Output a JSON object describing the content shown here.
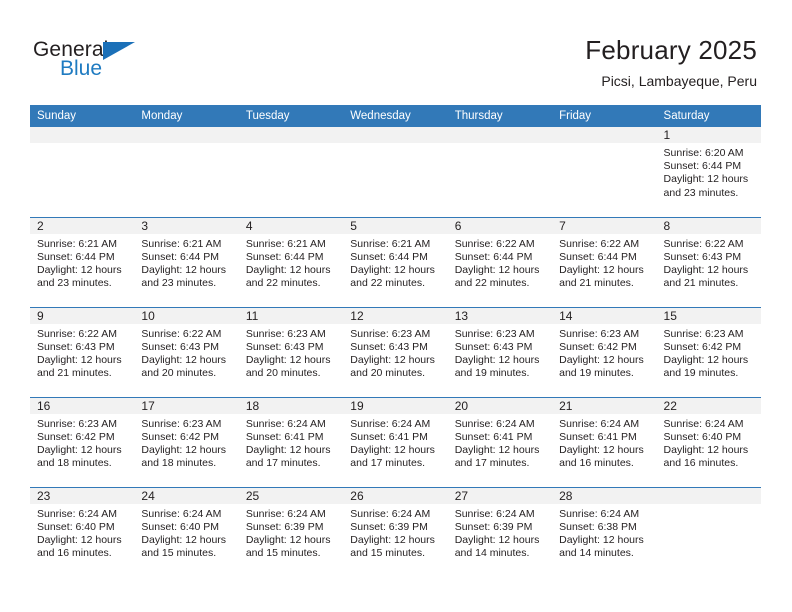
{
  "brand": {
    "name_part1": "General",
    "name_part2": "Blue",
    "triangle_color": "#1b70b8",
    "text_color": "#231f20",
    "blue_color": "#1f7bc1"
  },
  "header": {
    "title": "February 2025",
    "subtitle": "Picsi, Lambayeque, Peru"
  },
  "theme": {
    "header_bg": "#3279b8",
    "header_text": "#ffffff",
    "daynum_bg": "#f2f2f2",
    "grid_line": "#3279b8",
    "body_text": "#231f20"
  },
  "calendar": {
    "weekday_headers": [
      "Sunday",
      "Monday",
      "Tuesday",
      "Wednesday",
      "Thursday",
      "Friday",
      "Saturday"
    ],
    "weeks": [
      [
        {
          "day": "",
          "empty": true
        },
        {
          "day": "",
          "empty": true
        },
        {
          "day": "",
          "empty": true
        },
        {
          "day": "",
          "empty": true
        },
        {
          "day": "",
          "empty": true
        },
        {
          "day": "",
          "empty": true
        },
        {
          "day": "1",
          "sunrise": "Sunrise: 6:20 AM",
          "sunset": "Sunset: 6:44 PM",
          "daylight": "Daylight: 12 hours and 23 minutes."
        }
      ],
      [
        {
          "day": "2",
          "sunrise": "Sunrise: 6:21 AM",
          "sunset": "Sunset: 6:44 PM",
          "daylight": "Daylight: 12 hours and 23 minutes."
        },
        {
          "day": "3",
          "sunrise": "Sunrise: 6:21 AM",
          "sunset": "Sunset: 6:44 PM",
          "daylight": "Daylight: 12 hours and 23 minutes."
        },
        {
          "day": "4",
          "sunrise": "Sunrise: 6:21 AM",
          "sunset": "Sunset: 6:44 PM",
          "daylight": "Daylight: 12 hours and 22 minutes."
        },
        {
          "day": "5",
          "sunrise": "Sunrise: 6:21 AM",
          "sunset": "Sunset: 6:44 PM",
          "daylight": "Daylight: 12 hours and 22 minutes."
        },
        {
          "day": "6",
          "sunrise": "Sunrise: 6:22 AM",
          "sunset": "Sunset: 6:44 PM",
          "daylight": "Daylight: 12 hours and 22 minutes."
        },
        {
          "day": "7",
          "sunrise": "Sunrise: 6:22 AM",
          "sunset": "Sunset: 6:44 PM",
          "daylight": "Daylight: 12 hours and 21 minutes."
        },
        {
          "day": "8",
          "sunrise": "Sunrise: 6:22 AM",
          "sunset": "Sunset: 6:43 PM",
          "daylight": "Daylight: 12 hours and 21 minutes."
        }
      ],
      [
        {
          "day": "9",
          "sunrise": "Sunrise: 6:22 AM",
          "sunset": "Sunset: 6:43 PM",
          "daylight": "Daylight: 12 hours and 21 minutes."
        },
        {
          "day": "10",
          "sunrise": "Sunrise: 6:22 AM",
          "sunset": "Sunset: 6:43 PM",
          "daylight": "Daylight: 12 hours and 20 minutes."
        },
        {
          "day": "11",
          "sunrise": "Sunrise: 6:23 AM",
          "sunset": "Sunset: 6:43 PM",
          "daylight": "Daylight: 12 hours and 20 minutes."
        },
        {
          "day": "12",
          "sunrise": "Sunrise: 6:23 AM",
          "sunset": "Sunset: 6:43 PM",
          "daylight": "Daylight: 12 hours and 20 minutes."
        },
        {
          "day": "13",
          "sunrise": "Sunrise: 6:23 AM",
          "sunset": "Sunset: 6:43 PM",
          "daylight": "Daylight: 12 hours and 19 minutes."
        },
        {
          "day": "14",
          "sunrise": "Sunrise: 6:23 AM",
          "sunset": "Sunset: 6:42 PM",
          "daylight": "Daylight: 12 hours and 19 minutes."
        },
        {
          "day": "15",
          "sunrise": "Sunrise: 6:23 AM",
          "sunset": "Sunset: 6:42 PM",
          "daylight": "Daylight: 12 hours and 19 minutes."
        }
      ],
      [
        {
          "day": "16",
          "sunrise": "Sunrise: 6:23 AM",
          "sunset": "Sunset: 6:42 PM",
          "daylight": "Daylight: 12 hours and 18 minutes."
        },
        {
          "day": "17",
          "sunrise": "Sunrise: 6:23 AM",
          "sunset": "Sunset: 6:42 PM",
          "daylight": "Daylight: 12 hours and 18 minutes."
        },
        {
          "day": "18",
          "sunrise": "Sunrise: 6:24 AM",
          "sunset": "Sunset: 6:41 PM",
          "daylight": "Daylight: 12 hours and 17 minutes."
        },
        {
          "day": "19",
          "sunrise": "Sunrise: 6:24 AM",
          "sunset": "Sunset: 6:41 PM",
          "daylight": "Daylight: 12 hours and 17 minutes."
        },
        {
          "day": "20",
          "sunrise": "Sunrise: 6:24 AM",
          "sunset": "Sunset: 6:41 PM",
          "daylight": "Daylight: 12 hours and 17 minutes."
        },
        {
          "day": "21",
          "sunrise": "Sunrise: 6:24 AM",
          "sunset": "Sunset: 6:41 PM",
          "daylight": "Daylight: 12 hours and 16 minutes."
        },
        {
          "day": "22",
          "sunrise": "Sunrise: 6:24 AM",
          "sunset": "Sunset: 6:40 PM",
          "daylight": "Daylight: 12 hours and 16 minutes."
        }
      ],
      [
        {
          "day": "23",
          "sunrise": "Sunrise: 6:24 AM",
          "sunset": "Sunset: 6:40 PM",
          "daylight": "Daylight: 12 hours and 16 minutes."
        },
        {
          "day": "24",
          "sunrise": "Sunrise: 6:24 AM",
          "sunset": "Sunset: 6:40 PM",
          "daylight": "Daylight: 12 hours and 15 minutes."
        },
        {
          "day": "25",
          "sunrise": "Sunrise: 6:24 AM",
          "sunset": "Sunset: 6:39 PM",
          "daylight": "Daylight: 12 hours and 15 minutes."
        },
        {
          "day": "26",
          "sunrise": "Sunrise: 6:24 AM",
          "sunset": "Sunset: 6:39 PM",
          "daylight": "Daylight: 12 hours and 15 minutes."
        },
        {
          "day": "27",
          "sunrise": "Sunrise: 6:24 AM",
          "sunset": "Sunset: 6:39 PM",
          "daylight": "Daylight: 12 hours and 14 minutes."
        },
        {
          "day": "28",
          "sunrise": "Sunrise: 6:24 AM",
          "sunset": "Sunset: 6:38 PM",
          "daylight": "Daylight: 12 hours and 14 minutes."
        },
        {
          "day": "",
          "empty": true
        }
      ]
    ]
  }
}
